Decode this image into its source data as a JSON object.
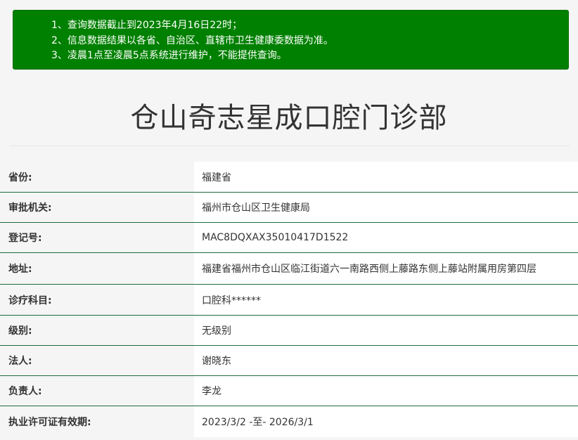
{
  "notice": {
    "lines": [
      "1、查询数据截止到2023年4月16日22时；",
      "2、信息数据结果以各省、自治区、直辖市卫生健康委数据为准。",
      "3、凌晨1点至凌晨5点系统进行维护，不能提供查询。"
    ],
    "background_color": "#008000"
  },
  "title": "仓山奇志星成口腔门诊部",
  "details": [
    {
      "label": "省份:",
      "value": "福建省"
    },
    {
      "label": "审批机关:",
      "value": "福州市仓山区卫生健康局"
    },
    {
      "label": "登记号:",
      "value": "MAC8DQXAX35010417D1522"
    },
    {
      "label": "地址:",
      "value": "福建省福州市仓山区临江街道六一南路西侧上藤路东侧上藤站附属用房第四层"
    },
    {
      "label": "诊疗科目:",
      "value": "口腔科******"
    },
    {
      "label": "级别:",
      "value": "无级别"
    },
    {
      "label": "法人:",
      "value": "谢晓东"
    },
    {
      "label": "负责人:",
      "value": "李龙"
    },
    {
      "label": "执业许可证有效期:",
      "value": "2023/3/2 -至- 2026/3/1"
    }
  ],
  "colors": {
    "row_divider": "#1f6b3b"
  }
}
